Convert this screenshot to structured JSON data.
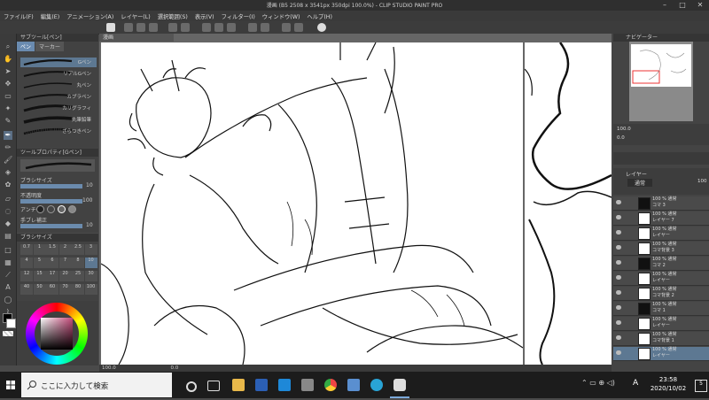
{
  "window": {
    "title": "漫画 (B5 2508 x 3541px 350dpi 100.0%) - CLIP STUDIO PAINT PRO"
  },
  "menu": [
    "ファイル(F)",
    "編集(E)",
    "アニメーション(A)",
    "レイヤー(L)",
    "選択範囲(S)",
    "表示(V)",
    "フィルター(I)",
    "ウィンドウ(W)",
    "ヘルプ(H)"
  ],
  "subtool": {
    "header": "サブツール[ペン]",
    "tabs": [
      "ペン",
      "マーカー"
    ],
    "brushes": [
      "Gペン",
      "リアルGペン",
      "丸ペン",
      "カブラペン",
      "カリグラフィ",
      "丸筆鉛筆",
      "ざらつきペン"
    ]
  },
  "toolprop": {
    "header": "ツールプロパティ[Gペン]",
    "brush_label": "Gペン",
    "brush_size_label": "ブラシサイズ",
    "brush_size": "10",
    "opacity_label": "不透明度",
    "opacity": "100",
    "antialias_label": "アンチ",
    "stabilize_label": "手ブレ補正",
    "stabilize": "10"
  },
  "brushsize": {
    "header": "ブラシサイズ",
    "sizes": [
      "0.7",
      "1",
      "1.5",
      "2",
      "2.5",
      "3",
      "4",
      "5",
      "6",
      "7",
      "8",
      "10",
      "12",
      "15",
      "17",
      "20",
      "25",
      "30",
      "40",
      "50",
      "60",
      "70",
      "80",
      "100"
    ]
  },
  "canvas": {
    "tab": "漫画",
    "zoom": "100.0",
    "status_coords": "0.0"
  },
  "navigator": {
    "header": "ナビゲーター",
    "zoom": "100.0",
    "angle": "0.0"
  },
  "layers": {
    "header": "レイヤー",
    "blend_mode": "通常",
    "opacity": "100",
    "items": [
      {
        "label": "100 % 通常",
        "name": "コマ 3",
        "type": "folder"
      },
      {
        "label": "100 % 通常",
        "name": "レイヤー 7",
        "type": "layer"
      },
      {
        "label": "100 % 通常",
        "name": "レイヤー",
        "type": "layer"
      },
      {
        "label": "100 % 通常",
        "name": "コマ背景 3",
        "type": "layer"
      },
      {
        "label": "100 % 通常",
        "name": "コマ 2",
        "type": "folder"
      },
      {
        "label": "100 % 通常",
        "name": "レイヤー",
        "type": "layer"
      },
      {
        "label": "100 % 通常",
        "name": "コマ背景 2",
        "type": "layer"
      },
      {
        "label": "100 % 通常",
        "name": "コマ 1",
        "type": "folder"
      },
      {
        "label": "100 % 通常",
        "name": "レイヤー",
        "type": "layer"
      },
      {
        "label": "100 % 通常",
        "name": "コマ背景 1",
        "type": "layer"
      },
      {
        "label": "100 % 通常",
        "name": "レイヤー",
        "type": "layer"
      }
    ]
  },
  "taskbar": {
    "search_placeholder": "ここに入力して検索",
    "time": "23:58",
    "date": "2020/10/02",
    "ime": "A",
    "notification_count": "5"
  },
  "colors": {
    "accent": "#5d7892",
    "main_color": "#000000",
    "sub_color": "#ffffff"
  }
}
